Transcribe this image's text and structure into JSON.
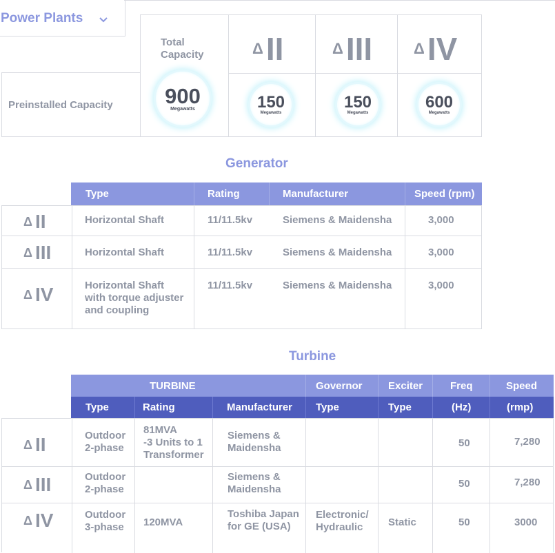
{
  "header": {
    "title": "Power Plants"
  },
  "capacity": {
    "total_label": "Total\nCapacity",
    "row_label": "Preinstalled Capacity",
    "units": [
      {
        "label": "II"
      },
      {
        "label": "III"
      },
      {
        "label": "IV"
      }
    ],
    "delta": "Δ",
    "total_value": "900",
    "unit_values": [
      "150",
      "150",
      "600"
    ],
    "unit_text": "Megawatts"
  },
  "generator": {
    "title": "Generator",
    "columns": [
      "Type",
      "Rating",
      "Manufacturer",
      "Speed (rpm)"
    ],
    "rows": [
      {
        "unit": "II",
        "type": "Horizontal Shaft",
        "rating": "11/11.5kv",
        "manufacturer": "Siemens & Maidensha",
        "speed": "3,000"
      },
      {
        "unit": "III",
        "type": "Horizontal Shaft",
        "rating": "11/11.5kv",
        "manufacturer": "Siemens & Maidensha",
        "speed": "3,000"
      },
      {
        "unit": "IV",
        "type": "Horizontal Shaft\nwith torque adjuster\nand coupling",
        "rating": "11/11.5kv",
        "manufacturer": "Siemens & Maidensha",
        "speed": "3,000"
      }
    ]
  },
  "turbine": {
    "title": "Turbine",
    "group_headers": [
      "TURBINE",
      "Governor",
      "Exciter",
      "Freq",
      "Speed"
    ],
    "sub_headers": [
      "Type",
      "Rating",
      "Manufacturer",
      "Type",
      "Type",
      "(Hz)",
      "(rmp)"
    ],
    "rows": [
      {
        "unit": "II",
        "type": "Outdoor\n2-phase",
        "rating": "81MVA\n-3 Units to 1\nTransformer",
        "manufacturer": "Siemens &\nMaidensha",
        "governor": "",
        "exciter": "",
        "freq": "50",
        "speed": "7,280"
      },
      {
        "unit": "III",
        "type": "Outdoor\n2-phase",
        "rating": "",
        "manufacturer": "Siemens &\nMaidensha",
        "governor": "",
        "exciter": "",
        "freq": "50",
        "speed": "7,280"
      },
      {
        "unit": "IV",
        "type": "Outdoor\n3-phase",
        "rating": "120MVA",
        "manufacturer": "Toshiba Japan\nfor GE (USA)",
        "governor": "Electronic/\nHydraulic",
        "exciter": "Static",
        "freq": "50",
        "speed": "3000"
      }
    ]
  },
  "colors": {
    "accent": "#8b97df",
    "header_dark": "#4f5dbd",
    "text_grey": "#8f95a3",
    "glow": "#bdf0fa"
  },
  "icons": {
    "dropdown": "chevron-down-icon"
  }
}
